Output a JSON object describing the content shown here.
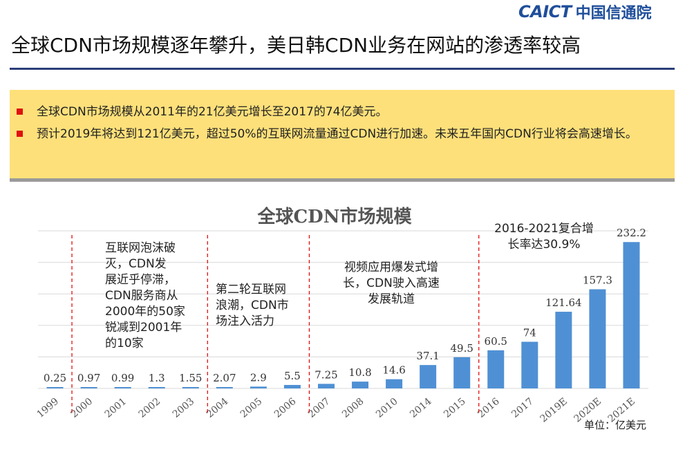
{
  "header": {
    "logo_en": "CAICT",
    "logo_cn": "中国信通院",
    "title": "全球CDN市场规模逐年攀升，美日韩CDN业务在网站的渗透率较高"
  },
  "callout": {
    "bullets": [
      "全球CDN市场规模从2011年的21亿美元增长至2017的74亿美元。",
      "预计2019年将达到121亿美元，超过50%的互联网流量通过CDN进行加速。未来五年国内CDN行业将会高速增长。"
    ]
  },
  "chart_data": {
    "type": "bar",
    "title": "全球CDN市场规模",
    "categories": [
      "1999",
      "2000",
      "2001",
      "2002",
      "2003",
      "2004",
      "2005",
      "2006",
      "2007",
      "2008",
      "2010",
      "2014",
      "2015",
      "2016",
      "2017",
      "2019E",
      "2020E",
      "2021E"
    ],
    "values": [
      0.25,
      0.97,
      0.99,
      1.3,
      1.55,
      2.07,
      2.9,
      5.5,
      7.25,
      10.8,
      14.6,
      37.1,
      49.5,
      60.5,
      74,
      121.64,
      157.3,
      232.2
    ],
    "value_labels": [
      "0.25",
      "0.97",
      "0.99",
      "1.3",
      "1.55",
      "2.07",
      "2.9",
      "5.5",
      "7.25",
      "10.8",
      "14.6",
      "37.1",
      "49.5",
      "60.5",
      "74",
      "121.64",
      "157.3",
      "232.2"
    ],
    "unit_label": "单位：亿美元",
    "ylim": [
      0,
      250
    ],
    "grid": true,
    "bar_color": "#4f90d4",
    "divider_color": "#e01010",
    "period_dividers_after_index": [
      0,
      4,
      7,
      12
    ],
    "annotations": [
      {
        "after_index": 0,
        "lines": [
          "互联网泡沫破",
          "灭，CDN发",
          "展近乎停滞，",
          "CDN服务商从",
          "2000年的50家",
          "锐减到2001年",
          "的10家"
        ]
      },
      {
        "after_index": 4,
        "lines": [
          "第二轮互联网",
          "浪潮，CDN市",
          "场注入活力"
        ]
      },
      {
        "after_index": 8,
        "lines": [
          "视频应用爆发式增",
          "长，CDN驶入高速",
          "发展轨道"
        ]
      },
      {
        "after_index": 13,
        "lines": [
          "2016-2021复合增",
          "长率达30.9%"
        ]
      }
    ]
  }
}
